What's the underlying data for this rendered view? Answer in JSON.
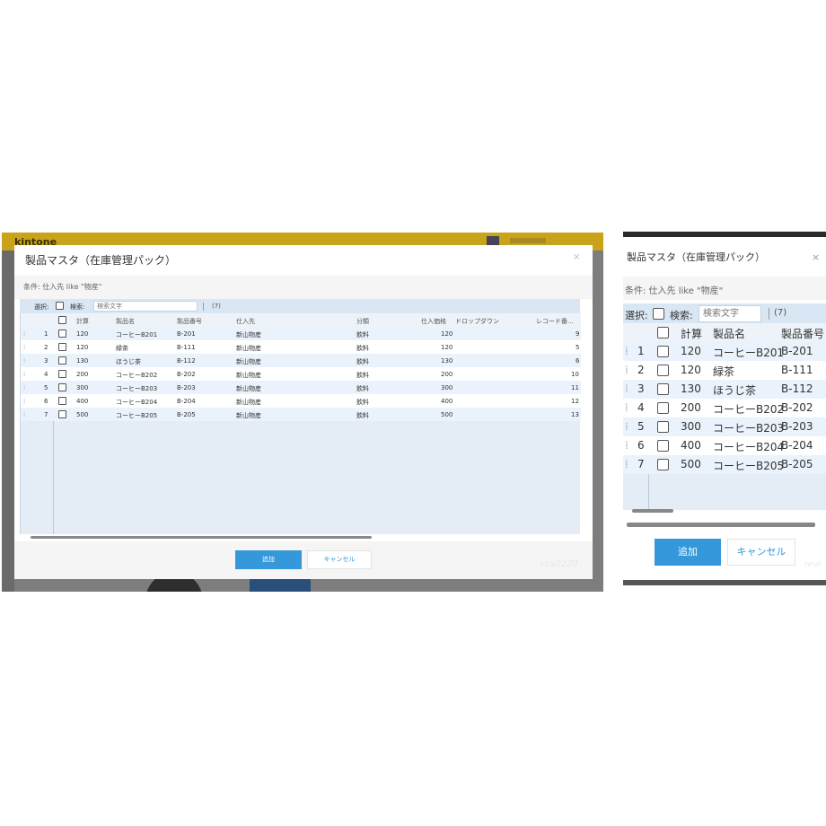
{
  "header": {
    "logo": "kintone"
  },
  "dialog": {
    "title": "製品マスタ（在庫管理パック）",
    "close": "×",
    "condition": "条件: 仕入先 like \"物産\"",
    "select_label": "選択:",
    "search_label": "検索:",
    "search_placeholder": "検索文字",
    "count": "(7)",
    "add_label": "追加",
    "cancel_label": "キャンセル",
    "signature": "rex0220"
  },
  "table": {
    "columns": [
      "計算",
      "製品名",
      "製品番号",
      "仕入先",
      "分類",
      "仕入価格",
      "ドロップダウン",
      "レコード番…"
    ],
    "rows": [
      {
        "no": "1",
        "calc": "120",
        "name": "コーヒーB201",
        "code": "B-201",
        "supplier": "新山物産",
        "category": "飲料",
        "price": "120",
        "record": "9"
      },
      {
        "no": "2",
        "calc": "120",
        "name": "緑茶",
        "code": "B-111",
        "supplier": "新山物産",
        "category": "飲料",
        "price": "120",
        "record": "5"
      },
      {
        "no": "3",
        "calc": "130",
        "name": "ほうじ茶",
        "code": "B-112",
        "supplier": "新山物産",
        "category": "飲料",
        "price": "130",
        "record": "6"
      },
      {
        "no": "4",
        "calc": "200",
        "name": "コーヒーB202",
        "code": "B-202",
        "supplier": "新山物産",
        "category": "飲料",
        "price": "200",
        "record": "10"
      },
      {
        "no": "5",
        "calc": "300",
        "name": "コーヒーB203",
        "code": "B-203",
        "supplier": "新山物産",
        "category": "飲料",
        "price": "300",
        "record": "11"
      },
      {
        "no": "6",
        "calc": "400",
        "name": "コーヒーB204",
        "code": "B-204",
        "supplier": "新山物産",
        "category": "飲料",
        "price": "400",
        "record": "12"
      },
      {
        "no": "7",
        "calc": "500",
        "name": "コーヒーB205",
        "code": "B-205",
        "supplier": "新山物産",
        "category": "飲料",
        "price": "500",
        "record": "13"
      }
    ]
  },
  "zoom": {
    "title": "製品マスタ（在庫管理パック）",
    "close": "×",
    "condition": "条件: 仕入先 like \"物産\"",
    "select_label": "選択:",
    "search_label": "検索:",
    "search_placeholder": "検索文字",
    "count": "(7)",
    "columns": [
      "計算",
      "製品名",
      "製品番号"
    ],
    "rows": [
      {
        "no": "1",
        "calc": "120",
        "name": "コーヒーB201",
        "code": "B-201"
      },
      {
        "no": "2",
        "calc": "120",
        "name": "緑茶",
        "code": "B-111"
      },
      {
        "no": "3",
        "calc": "130",
        "name": "ほうじ茶",
        "code": "B-112"
      },
      {
        "no": "4",
        "calc": "200",
        "name": "コーヒーB202",
        "code": "B-202"
      },
      {
        "no": "5",
        "calc": "300",
        "name": "コーヒーB203",
        "code": "B-203"
      },
      {
        "no": "6",
        "calc": "400",
        "name": "コーヒーB204",
        "code": "B-204"
      },
      {
        "no": "7",
        "calc": "500",
        "name": "コーヒーB205",
        "code": "B-205"
      }
    ],
    "add_label": "追加",
    "cancel_label": "キャンセル",
    "signature": "rex0"
  }
}
